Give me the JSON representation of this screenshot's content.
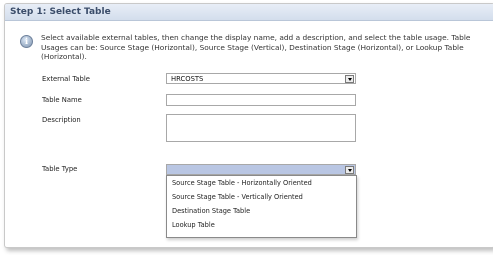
{
  "header": {
    "title": "Step 1: Select Table"
  },
  "info": {
    "text": "Select available external tables, then change the display name, add a description, and select the table usage. Table Usages can be: Source Stage (Horizontal), Source Stage (Vertical), Destination Stage (Horizontal), or Lookup Table (Horizontal)."
  },
  "form": {
    "external_table_label": "External Table",
    "external_table_value": "HRCOSTS",
    "table_name_label": "Table Name",
    "table_name_value": "",
    "description_label": "Description",
    "description_value": "",
    "table_type_label": "Table Type",
    "table_type_value": ""
  },
  "table_type_options": [
    "Source Stage Table - Horizontally Oriented",
    "Source Stage Table - Vertically Oriented",
    "Destination Stage Table",
    "Lookup Table"
  ]
}
